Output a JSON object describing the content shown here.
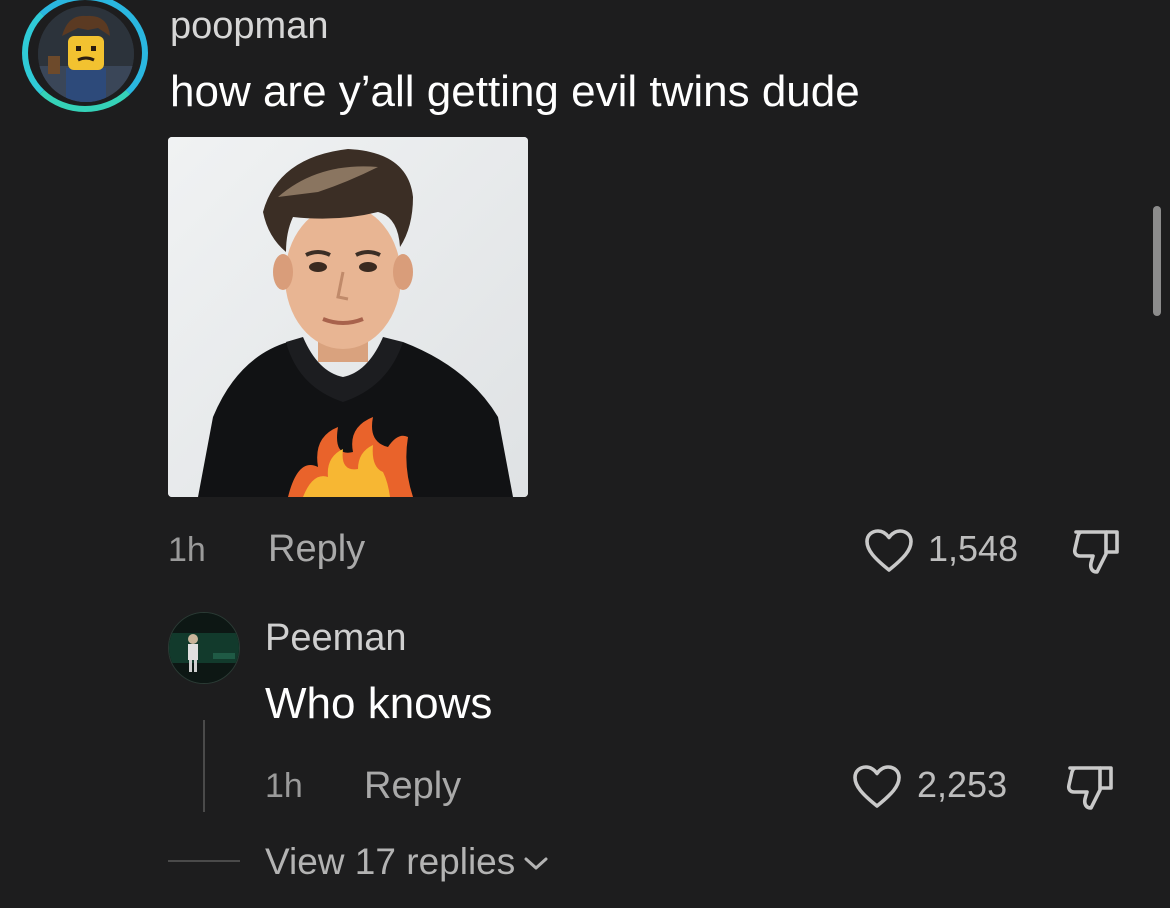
{
  "colors": {
    "background": "#1d1d1e",
    "ring": "#2ab7e0",
    "text_primary": "#ffffff",
    "text_secondary": "#9a9a9a"
  },
  "comment": {
    "username": "poopman",
    "text": "how are y’all getting evil twins dude",
    "time": "1h",
    "reply_label": "Reply",
    "likes": "1,548",
    "like_icon": "heart-outline-icon",
    "dislike_icon": "thumbs-down-icon"
  },
  "reply": {
    "username": "Peeman",
    "text": "Who knows",
    "time": "1h",
    "reply_label": "Reply",
    "likes": "2,253",
    "like_icon": "heart-outline-icon",
    "dislike_icon": "thumbs-down-icon"
  },
  "view_replies": {
    "label": "View 17 replies",
    "icon": "chevron-down-icon"
  }
}
